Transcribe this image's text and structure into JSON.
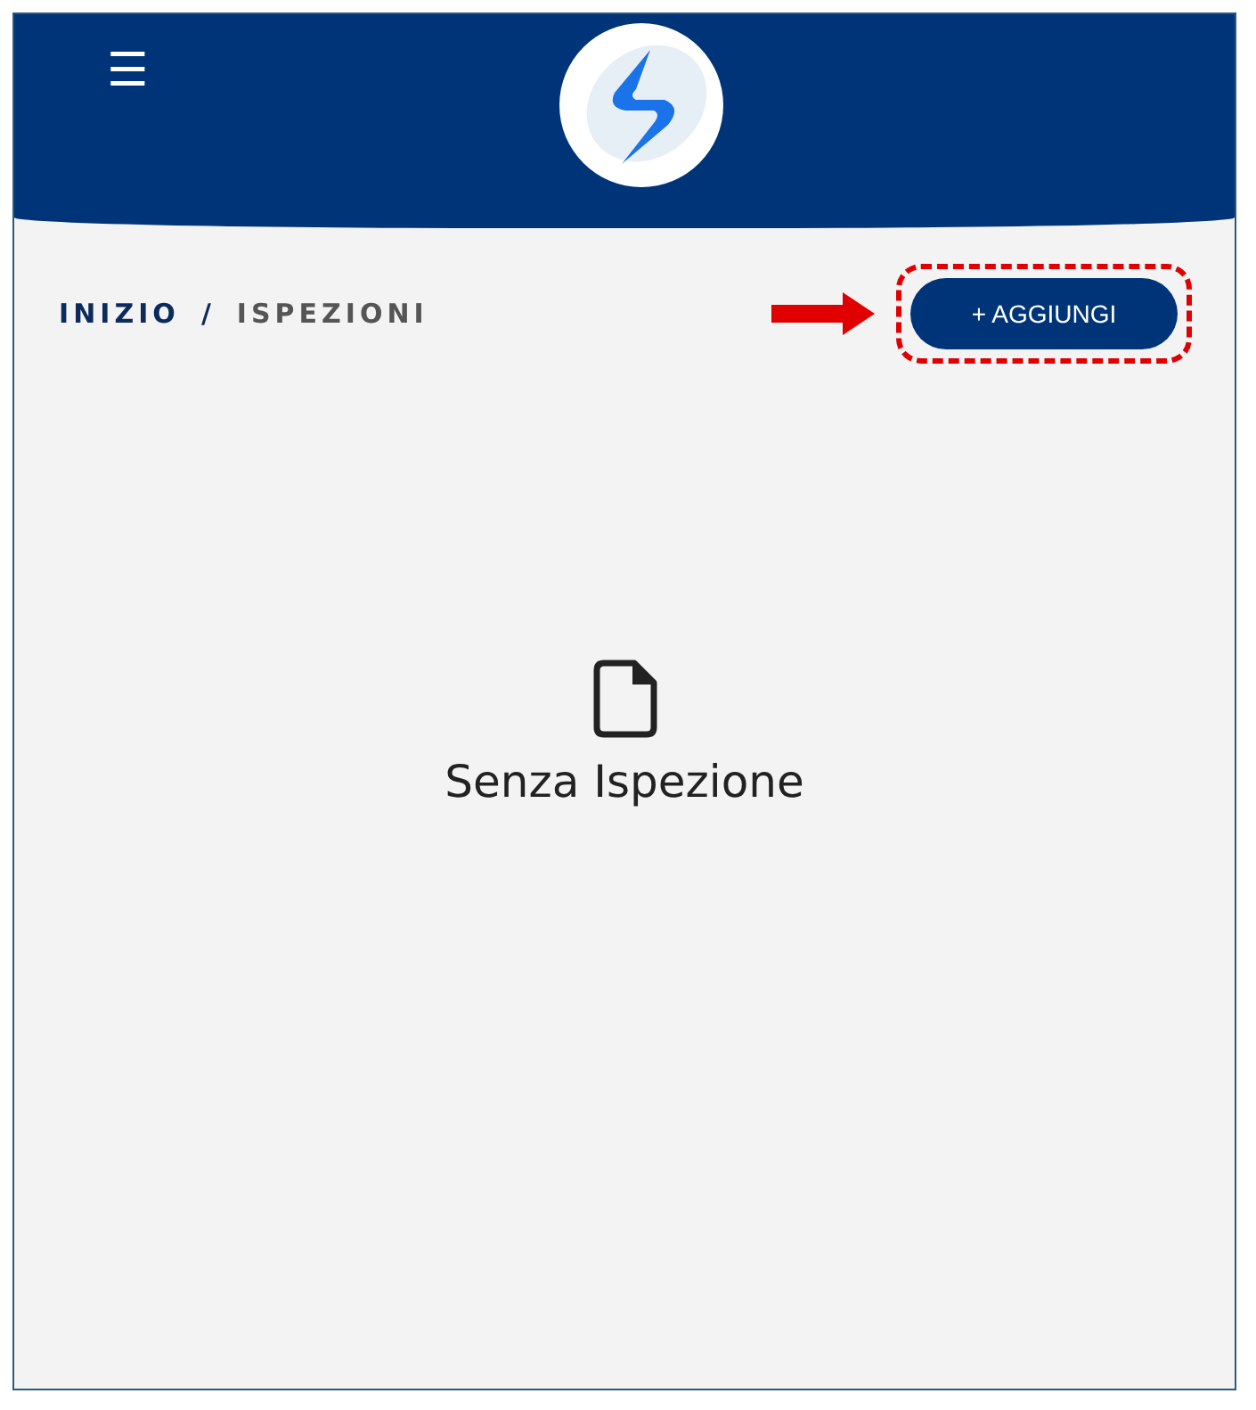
{
  "header": {
    "menu_icon": "☰"
  },
  "breadcrumb": [
    {
      "label": "INIZIO",
      "current": false
    },
    {
      "label": "/",
      "current": false
    },
    {
      "label": "ISPEZIONI",
      "current": true
    }
  ],
  "add_button": {
    "label": "+ AGGIUNGI",
    "highlighted": true
  },
  "empty_state": {
    "message": "Senza Ispezione"
  }
}
